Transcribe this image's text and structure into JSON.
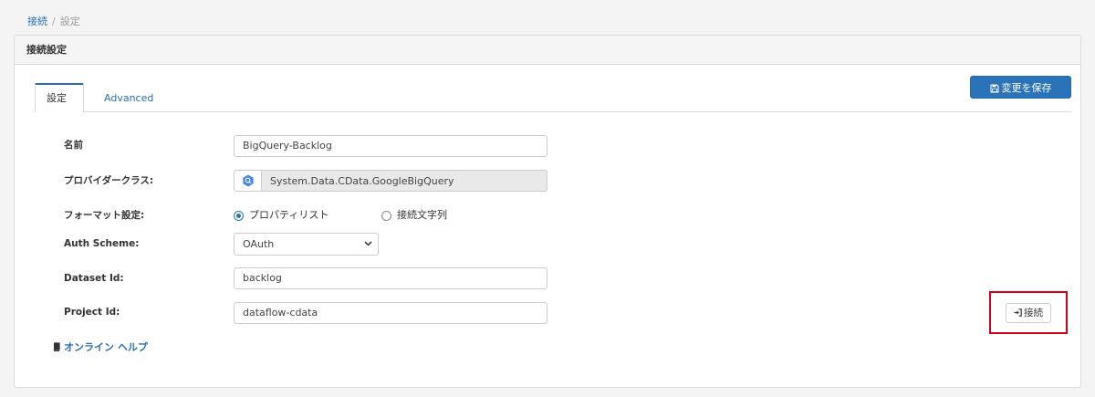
{
  "breadcrumb": {
    "link": "接続",
    "separator": "/",
    "current": "設定"
  },
  "panel": {
    "title": "接続設定"
  },
  "toolbar": {
    "save_label": "変更を保存",
    "save_icon": "floppy-disk-icon"
  },
  "tabs": [
    {
      "label": "設定",
      "active": true
    },
    {
      "label": "Advanced",
      "active": false
    }
  ],
  "form": {
    "name": {
      "label": "名前",
      "value": "BigQuery-Backlog"
    },
    "provider": {
      "label": "プロバイダークラス:",
      "value": "System.Data.CData.GoogleBigQuery",
      "icon": "bigquery-icon"
    },
    "format": {
      "label": "フォーマット設定:",
      "options": [
        {
          "label": "プロパティリスト",
          "checked": true
        },
        {
          "label": "接続文字列",
          "checked": false
        }
      ]
    },
    "auth_scheme": {
      "label": "Auth Scheme:",
      "value": "OAuth"
    },
    "dataset_id": {
      "label": "Dataset Id:",
      "value": "backlog"
    },
    "project_id": {
      "label": "Project Id:",
      "value": "dataflow-cdata"
    }
  },
  "help": {
    "label": "オンライン ヘルプ",
    "icon": "book-icon"
  },
  "connect": {
    "label": "接続",
    "icon": "sign-in-icon"
  },
  "colors": {
    "primary": "#2a73b8",
    "link": "#2a6ebb",
    "highlight": "#d0021b"
  }
}
